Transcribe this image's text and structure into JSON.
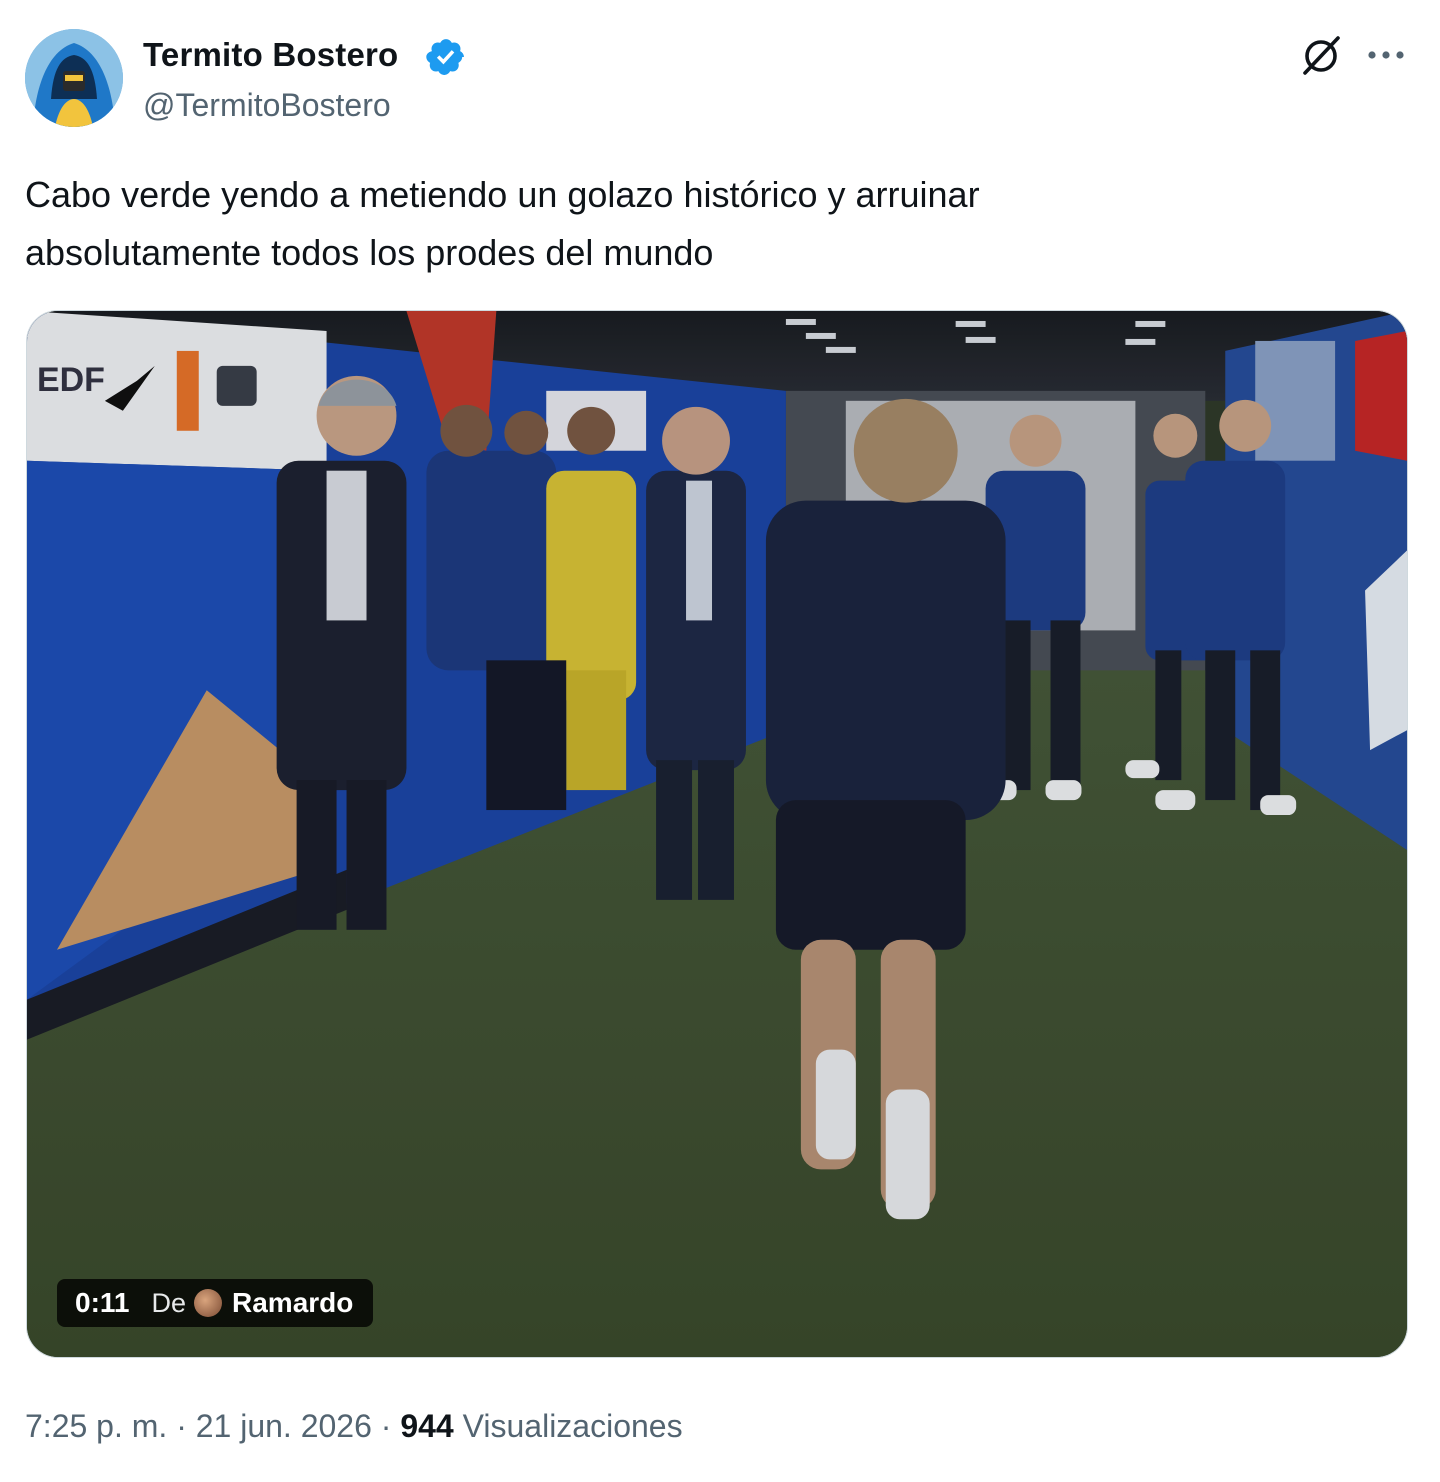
{
  "author": {
    "display_name": "Termito Bostero",
    "handle": "@TermitoBostero",
    "verified": true,
    "verified_color": "#1d9bf0"
  },
  "header_icons": {
    "grok": "grok-icon",
    "more": "more-icon"
  },
  "tweet": {
    "text_line_1": "Cabo verde yendo a metiendo un golazo histórico y arruinar",
    "text_line_2": "absolutamente todos los prodes del mundo"
  },
  "video": {
    "duration": "0:11",
    "from_label": "De",
    "source_name": "Ramardo"
  },
  "meta": {
    "time": "7:25 p. m.",
    "separator": " · ",
    "date": "21 jun. 2026",
    "views_count": "944",
    "views_label": "Visualizaciones"
  },
  "colors": {
    "text_primary": "#0f1419",
    "text_secondary": "#536471",
    "accent": "#1d9bf0"
  }
}
